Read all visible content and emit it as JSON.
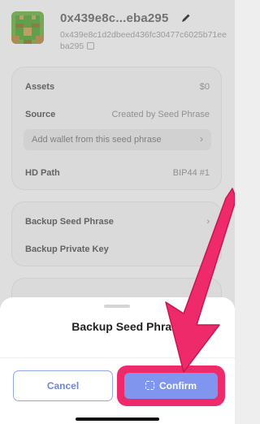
{
  "wallet": {
    "name": "0x439e8c...eba295",
    "address": "0x439e8c1d2dbeed436fc30477c6025b71eeba295"
  },
  "info": {
    "assets_label": "Assets",
    "assets_value": "$0",
    "source_label": "Source",
    "source_value": "Created by Seed Phrase",
    "add_wallet": "Add wallet from this seed phrase",
    "hd_label": "HD Path",
    "hd_value": "BIP44 #1"
  },
  "backup": {
    "seed_phrase": "Backup Seed Phrase",
    "private_key": "Backup Private Key"
  },
  "sheet": {
    "title": "Backup Seed Phrase",
    "cancel": "Cancel",
    "confirm": "Confirm"
  },
  "icons": {
    "edit": "pencil-icon",
    "copy": "copy-icon",
    "chevron": "chevron-right-icon",
    "scan": "scan-icon"
  },
  "colors": {
    "accent": "#7f95ee",
    "annotation": "#ee2a6b",
    "avatar_green": "#6aa84f"
  }
}
